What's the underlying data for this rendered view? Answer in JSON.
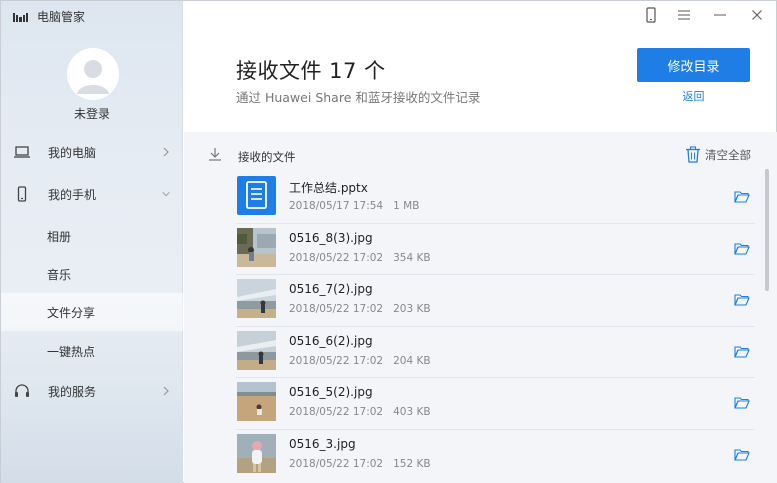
{
  "app": {
    "title": "电脑管家"
  },
  "user": {
    "login_label": "未登录"
  },
  "sidebar": {
    "items": [
      {
        "label": "我的电脑",
        "icon": "laptop-icon"
      },
      {
        "label": "我的手机",
        "icon": "phone-icon"
      },
      {
        "label": "我的服务",
        "icon": "headset-icon"
      }
    ],
    "sub_items": [
      {
        "label": "相册"
      },
      {
        "label": "音乐"
      },
      {
        "label": "文件分享",
        "active": true
      },
      {
        "label": "一键热点"
      }
    ]
  },
  "titlebar": {
    "icons": [
      "phone-outline-icon",
      "menu-icon",
      "minimize-icon",
      "close-icon"
    ]
  },
  "header": {
    "title": "接收文件 17 个",
    "subtitle": "通过 Huawei Share 和蓝牙接收的文件记录",
    "primary_button": "修改目录",
    "back_link": "返回"
  },
  "panel": {
    "title": "接收的文件",
    "clear_all": "清空全部"
  },
  "files": [
    {
      "name": "工作总结.pptx",
      "date": "2018/05/17 17:54",
      "size": "1 MB",
      "kind": "doc"
    },
    {
      "name": "0516_8(3).jpg",
      "date": "2018/05/22 17:02",
      "size": "354 KB",
      "kind": "photo-a"
    },
    {
      "name": "0516_7(2).jpg",
      "date": "2018/05/22 17:02",
      "size": "203 KB",
      "kind": "photo-b"
    },
    {
      "name": "0516_6(2).jpg",
      "date": "2018/05/22 17:02",
      "size": "204 KB",
      "kind": "photo-b"
    },
    {
      "name": "0516_5(2).jpg",
      "date": "2018/05/22 17:02",
      "size": "403 KB",
      "kind": "photo-c"
    },
    {
      "name": "0516_3.jpg",
      "date": "2018/05/22 17:02",
      "size": "152 KB",
      "kind": "photo-d"
    }
  ],
  "colors": {
    "accent": "#1f7ee6",
    "sidebar_bg": "#e6ecf3",
    "panel_bg": "#f3f5f8"
  }
}
